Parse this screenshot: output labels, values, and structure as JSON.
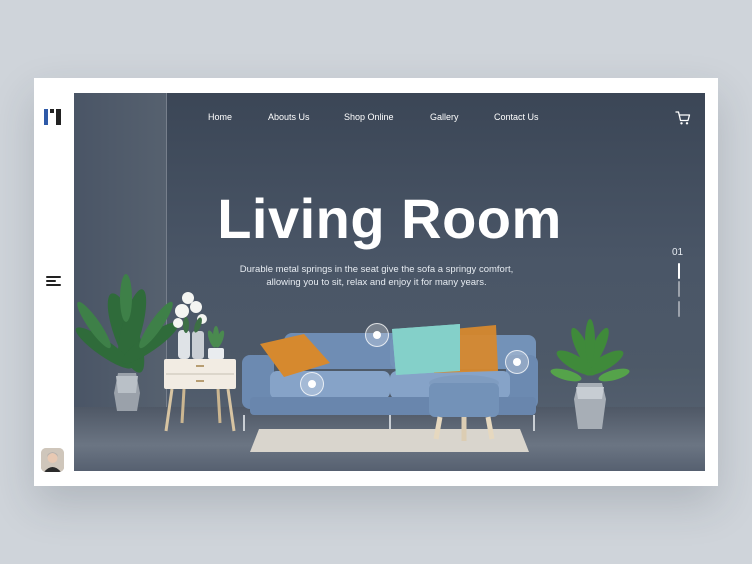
{
  "brand": {
    "logo_icon": "logo-bars-icon",
    "accent": "#2f5aa8",
    "dark": "#222222"
  },
  "nav": {
    "items": [
      {
        "label": "Home"
      },
      {
        "label": "Abouts Us"
      },
      {
        "label": "Shop Online"
      },
      {
        "label": "Gallery"
      },
      {
        "label": "Contact Us"
      }
    ],
    "cart_icon": "shopping-cart-icon"
  },
  "hero": {
    "title": "Living Room",
    "description_line1": "Durable metal springs in the seat give the sofa a springy comfort,",
    "description_line2": "allowing you to sit, relax and enjoy it for many years.",
    "slide_number": "01"
  },
  "sidebar": {
    "menu_icon": "hamburger-menu-icon",
    "avatar_icon": "user-avatar"
  },
  "colors": {
    "sofa": "#7f9cc0",
    "pillow_orange": "#d6892e",
    "pillow_teal": "#7ecbc4",
    "wall": "#46505f"
  }
}
